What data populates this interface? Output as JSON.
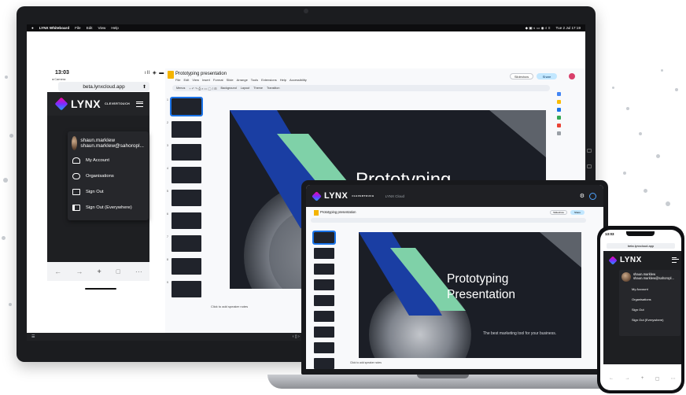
{
  "menubar": {
    "app": "LYNX Whiteboard",
    "items": [
      "File",
      "Edit",
      "View",
      "Help"
    ],
    "clock": "Tue 2 Jul 17:19"
  },
  "phone": {
    "time": "13:03",
    "back": "◂ Camera",
    "status": "ıll ◈ ▬",
    "url": "beta.lynxcloud.app",
    "logo": "LYNX",
    "logo_sub": "CLEVERTOUCH",
    "user_name": "shaun.marklew",
    "user_email": "shaun.marklew@sahoropl...",
    "menu": [
      "My Account",
      "Organisations",
      "Sign Out",
      "Sign Out (Everywhere)"
    ]
  },
  "slides": {
    "doc_title": "Prototyping presentation",
    "menus": [
      "File",
      "Edit",
      "View",
      "Insert",
      "Format",
      "Slide",
      "Arrange",
      "Tools",
      "Extensions",
      "Help",
      "Accessibility"
    ],
    "toolbar": [
      "Menus",
      "Background",
      "Layout",
      "Theme",
      "Transition"
    ],
    "slideshow": "Slideshow",
    "share": "Share",
    "thumb_numbers": [
      "1",
      "2",
      "3",
      "4",
      "5",
      "6",
      "7",
      "8",
      "9"
    ],
    "notes": "Click to add speaker notes",
    "slide_title_1": "Prototyping",
    "slide_title_2": "Presentation",
    "tagline": "The best marketing tool for your business."
  },
  "laptop": {
    "logo": "LYNX",
    "logo_sub": "CLEVERTOUCH",
    "section": "LYNX Cloud"
  },
  "colors": {
    "blue": "#1a3ea3",
    "green": "#7fd1a8",
    "bg": "#1b1e26",
    "accent": "#1a73e8"
  }
}
